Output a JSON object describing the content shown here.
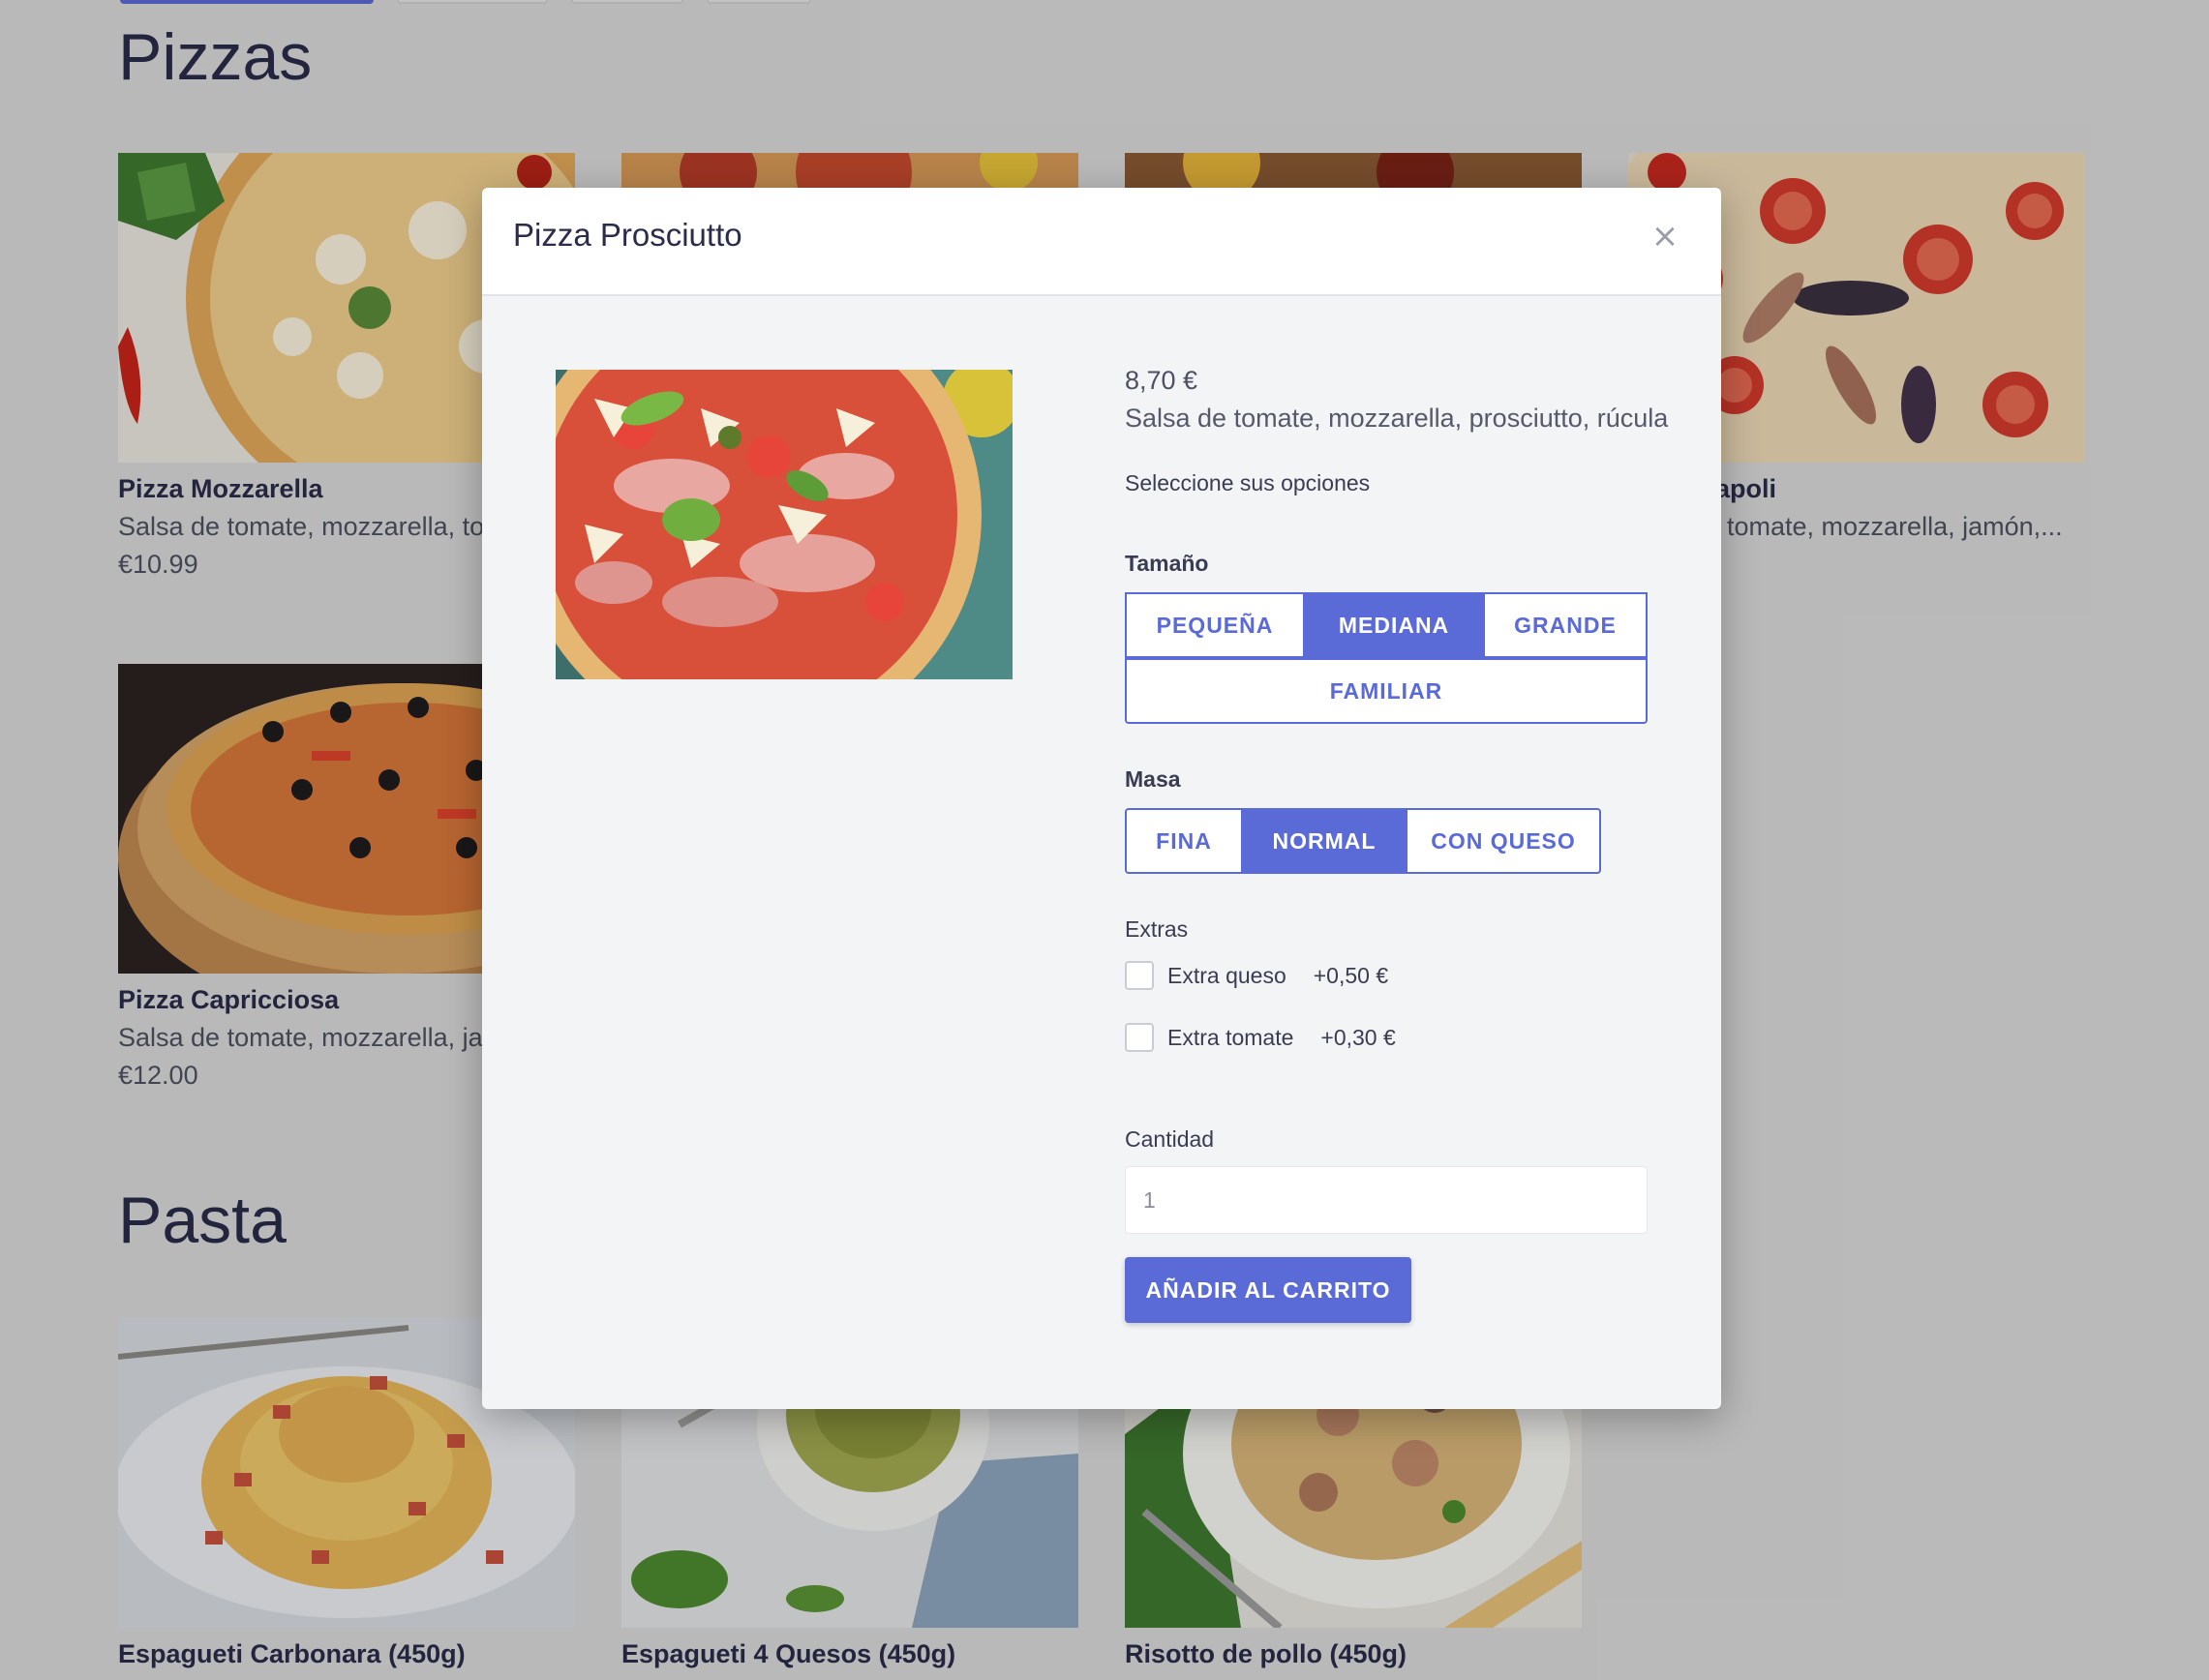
{
  "sections": {
    "pizzas_title": "Pizzas",
    "pasta_title": "Pasta"
  },
  "pizzas": [
    {
      "name": "Pizza Mozzarella",
      "desc": "Salsa de tomate, mozzarella, tor",
      "price": "€10.99"
    },
    {
      "name": "apoli",
      "desc": "tomate, mozzarella, jamón,..."
    },
    {
      "name": "Pizza Capricciosa",
      "desc": "Salsa de tomate, mozzarella, jar",
      "price": "€12.00"
    }
  ],
  "pasta": [
    {
      "name": "Espagueti Carbonara (450g)"
    },
    {
      "name": "Espagueti 4 Quesos (450g)"
    },
    {
      "name": "Risotto de pollo (450g)"
    }
  ],
  "modal": {
    "title": "Pizza Prosciutto",
    "close": "×",
    "price": "8,70 €",
    "description": "Salsa de tomate, mozzarella, prosciutto, rúcula",
    "choose_label": "Seleccione sus opciones",
    "size": {
      "label": "Tamaño",
      "options": [
        "PEQUEÑA",
        "MEDIANA",
        "GRANDE",
        "FAMILIAR"
      ],
      "selected": "MEDIANA"
    },
    "dough": {
      "label": "Masa",
      "options": [
        "FINA",
        "NORMAL",
        "CON QUESO"
      ],
      "selected": "NORMAL"
    },
    "extras": {
      "label": "Extras",
      "items": [
        {
          "name": "Extra queso",
          "price": "+0,50 €",
          "checked": false
        },
        {
          "name": "Extra tomate",
          "price": "+0,30 €",
          "checked": false
        }
      ]
    },
    "quantity": {
      "label": "Cantidad",
      "value": "1"
    },
    "add_button": "AÑADIR AL CARRITO"
  },
  "colors": {
    "accent": "#5a6ad6",
    "title": "#2a2c4a",
    "background": "#dadada",
    "modal_body": "#f3f4f6"
  }
}
